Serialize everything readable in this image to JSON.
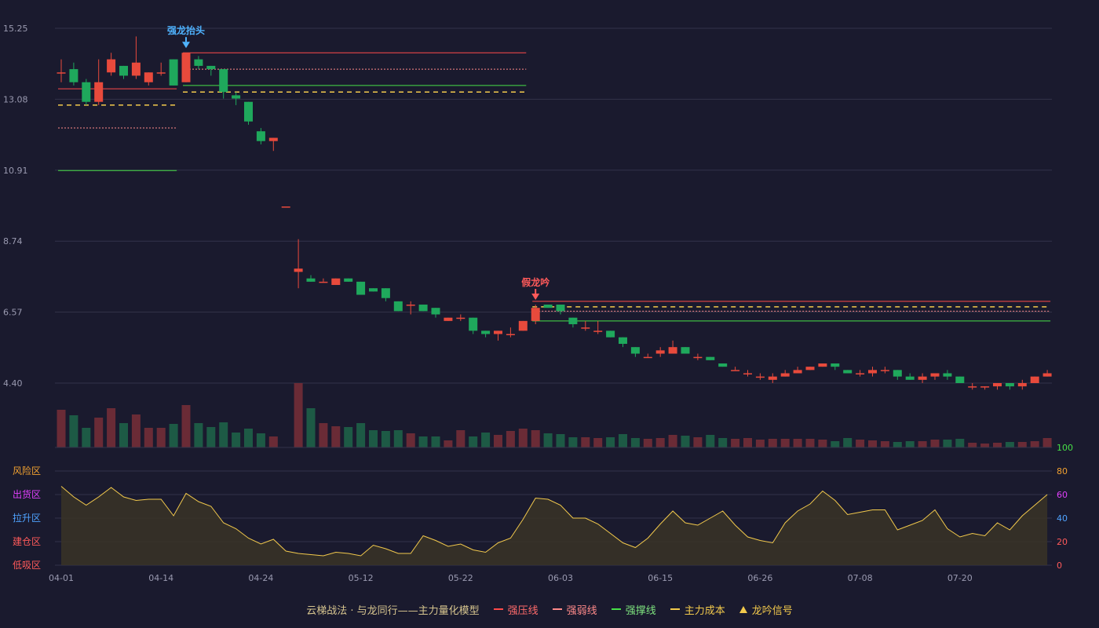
{
  "chart_data": {
    "type": "candlestick",
    "price_axis": {
      "ticks": [
        4.4,
        6.57,
        8.74,
        10.91,
        13.08,
        15.25
      ],
      "min": 4.4,
      "max": 15.25
    },
    "x_labels": [
      "04-01",
      "04-14",
      "04-24",
      "05-12",
      "05-22",
      "06-03",
      "06-15",
      "06-26",
      "07-08",
      "07-20"
    ],
    "x_label_indices": [
      0,
      8,
      16,
      24,
      32,
      40,
      48,
      56,
      64,
      72
    ],
    "candles": [
      [
        13.9,
        13.9,
        14.3,
        13.6
      ],
      [
        14.0,
        13.6,
        14.2,
        13.5
      ],
      [
        13.6,
        13.0,
        13.7,
        12.9
      ],
      [
        13.0,
        13.6,
        14.3,
        12.9
      ],
      [
        13.9,
        14.3,
        14.5,
        13.8
      ],
      [
        14.1,
        13.8,
        14.1,
        13.7
      ],
      [
        13.8,
        14.2,
        15.0,
        13.7
      ],
      [
        13.6,
        13.9,
        13.9,
        13.5
      ],
      [
        13.9,
        13.9,
        14.2,
        13.8
      ],
      [
        14.3,
        13.5,
        14.3,
        13.5
      ],
      [
        13.6,
        14.5,
        14.5,
        13.6
      ],
      [
        14.3,
        14.1,
        14.4,
        14.0
      ],
      [
        14.1,
        14.0,
        14.1,
        13.8
      ],
      [
        14.0,
        13.3,
        14.0,
        13.1
      ],
      [
        13.2,
        13.1,
        13.3,
        12.9
      ],
      [
        13.0,
        12.4,
        13.0,
        12.3
      ],
      [
        12.1,
        11.8,
        12.2,
        11.7
      ],
      [
        11.8,
        11.9,
        11.9,
        11.5
      ],
      [
        9.8,
        9.8,
        9.8,
        9.8
      ],
      [
        7.8,
        7.9,
        8.8,
        7.3
      ],
      [
        7.6,
        7.5,
        7.7,
        7.5
      ],
      [
        7.5,
        7.5,
        7.6,
        7.5
      ],
      [
        7.4,
        7.6,
        7.6,
        7.4
      ],
      [
        7.6,
        7.5,
        7.6,
        7.5
      ],
      [
        7.5,
        7.1,
        7.5,
        7.1
      ],
      [
        7.3,
        7.2,
        7.3,
        7.2
      ],
      [
        7.3,
        7.0,
        7.3,
        6.9
      ],
      [
        6.9,
        6.6,
        6.9,
        6.6
      ],
      [
        6.8,
        6.8,
        6.9,
        6.5
      ],
      [
        6.8,
        6.6,
        6.8,
        6.6
      ],
      [
        6.7,
        6.5,
        6.7,
        6.4
      ],
      [
        6.3,
        6.4,
        6.4,
        6.3
      ],
      [
        6.4,
        6.4,
        6.5,
        6.3
      ],
      [
        6.4,
        6.0,
        6.4,
        5.9
      ],
      [
        6.0,
        5.9,
        6.0,
        5.8
      ],
      [
        5.9,
        6.0,
        6.0,
        5.7
      ],
      [
        5.9,
        5.9,
        6.1,
        5.8
      ],
      [
        6.0,
        6.3,
        6.3,
        6.0
      ],
      [
        6.3,
        6.7,
        6.8,
        6.2
      ],
      [
        6.8,
        6.7,
        6.8,
        6.7
      ],
      [
        6.8,
        6.6,
        6.8,
        6.5
      ],
      [
        6.4,
        6.2,
        6.4,
        6.1
      ],
      [
        6.1,
        6.1,
        6.3,
        6.0
      ],
      [
        6.0,
        6.0,
        6.3,
        5.9
      ],
      [
        6.0,
        5.8,
        6.0,
        5.8
      ],
      [
        5.8,
        5.6,
        5.8,
        5.5
      ],
      [
        5.5,
        5.3,
        5.5,
        5.2
      ],
      [
        5.2,
        5.2,
        5.3,
        5.2
      ],
      [
        5.3,
        5.4,
        5.5,
        5.2
      ],
      [
        5.3,
        5.5,
        5.7,
        5.3
      ],
      [
        5.5,
        5.3,
        5.5,
        5.3
      ],
      [
        5.2,
        5.2,
        5.3,
        5.1
      ],
      [
        5.2,
        5.1,
        5.2,
        5.1
      ],
      [
        5.0,
        4.9,
        5.0,
        4.9
      ],
      [
        4.8,
        4.8,
        4.9,
        4.8
      ],
      [
        4.7,
        4.7,
        4.8,
        4.6
      ],
      [
        4.6,
        4.6,
        4.7,
        4.5
      ],
      [
        4.5,
        4.6,
        4.7,
        4.4
      ],
      [
        4.6,
        4.7,
        4.8,
        4.6
      ],
      [
        4.7,
        4.8,
        4.9,
        4.7
      ],
      [
        4.8,
        4.9,
        4.9,
        4.8
      ],
      [
        4.9,
        5.0,
        5.0,
        4.9
      ],
      [
        5.0,
        4.9,
        5.0,
        4.8
      ],
      [
        4.8,
        4.7,
        4.8,
        4.7
      ],
      [
        4.7,
        4.7,
        4.8,
        4.6
      ],
      [
        4.7,
        4.8,
        4.9,
        4.6
      ],
      [
        4.8,
        4.8,
        4.9,
        4.7
      ],
      [
        4.8,
        4.6,
        4.8,
        4.5
      ],
      [
        4.6,
        4.5,
        4.7,
        4.5
      ],
      [
        4.5,
        4.6,
        4.7,
        4.4
      ],
      [
        4.6,
        4.7,
        4.7,
        4.5
      ],
      [
        4.7,
        4.6,
        4.8,
        4.5
      ],
      [
        4.6,
        4.4,
        4.6,
        4.4
      ],
      [
        4.3,
        4.3,
        4.4,
        4.2
      ],
      [
        4.3,
        4.3,
        4.3,
        4.2
      ],
      [
        4.3,
        4.4,
        4.4,
        4.2
      ],
      [
        4.4,
        4.3,
        4.4,
        4.2
      ],
      [
        4.3,
        4.4,
        4.5,
        4.2
      ],
      [
        4.4,
        4.6,
        4.6,
        4.4
      ],
      [
        4.6,
        4.7,
        4.8,
        4.6
      ]
    ],
    "volumes": [
      48,
      41,
      25,
      38,
      50,
      31,
      42,
      25,
      25,
      30,
      54,
      31,
      26,
      32,
      19,
      24,
      18,
      14,
      0,
      82,
      50,
      31,
      27,
      26,
      31,
      22,
      21,
      22,
      18,
      14,
      14,
      9,
      22,
      14,
      19,
      16,
      21,
      24,
      22,
      18,
      17,
      13,
      13,
      12,
      13,
      17,
      12,
      11,
      12,
      16,
      15,
      13,
      16,
      12,
      11,
      12,
      10,
      11,
      11,
      11,
      11,
      10,
      8,
      12,
      10,
      9,
      8,
      7,
      8,
      8,
      10,
      10,
      11,
      6,
      5,
      6,
      7,
      7,
      8,
      12
    ],
    "hlines": [
      {
        "kind": "强压线",
        "value": 14.5,
        "from": 10,
        "to": 37
      },
      {
        "kind": "强弱线",
        "value": 14.0,
        "from": 10,
        "to": 37
      },
      {
        "kind": "强撑线",
        "value": 13.5,
        "from": 10,
        "to": 37
      },
      {
        "kind": "主力成本",
        "value": 13.3,
        "from": 10,
        "to": 37
      },
      {
        "kind": "强压线",
        "value": 13.4,
        "from": 0,
        "to": 9
      },
      {
        "kind": "主力成本",
        "value": 12.9,
        "from": 0,
        "to": 9
      },
      {
        "kind": "强弱线",
        "value": 12.2,
        "from": 0,
        "to": 9
      },
      {
        "kind": "强撑线",
        "value": 10.9,
        "from": 0,
        "to": 9
      },
      {
        "kind": "强压线",
        "value": 6.9,
        "from": 38,
        "to": 79
      },
      {
        "kind": "主力成本",
        "value": 6.73,
        "from": 38,
        "to": 79
      },
      {
        "kind": "强弱线",
        "value": 6.6,
        "from": 38,
        "to": 79
      },
      {
        "kind": "强撑线",
        "value": 6.3,
        "from": 38,
        "to": 79
      }
    ],
    "annotations": [
      {
        "text": "强龙抬头",
        "index": 10,
        "color": "#4fb3ff"
      },
      {
        "text": "假龙吟",
        "index": 38,
        "color": "#ff5a5a"
      }
    ],
    "indicator": {
      "values": [
        67,
        58,
        51,
        58,
        66,
        58,
        55,
        56,
        56,
        42,
        61,
        54,
        50,
        36,
        31,
        23,
        18,
        22,
        12,
        10,
        9,
        8,
        11,
        10,
        8,
        17,
        14,
        10,
        10,
        25,
        21,
        16,
        18,
        13,
        11,
        19,
        23,
        39,
        57,
        56,
        51,
        40,
        40,
        35,
        27,
        19,
        15,
        23,
        35,
        46,
        36,
        34,
        40,
        46,
        34,
        24,
        21,
        19,
        36,
        46,
        52,
        63,
        55,
        43,
        45,
        47,
        47,
        30,
        34,
        38,
        47,
        31,
        24,
        27,
        25,
        36,
        30,
        42,
        51,
        60
      ],
      "zones": [
        "风险区",
        "出货区",
        "拉升区",
        "建仓区",
        "低吸区"
      ],
      "zone_colors": [
        "#f0a030",
        "#e040fb",
        "#4fa3ff",
        "#ff5a5a",
        "#ff5a5a"
      ],
      "ticks": [
        0,
        20,
        40,
        60,
        80,
        100
      ],
      "tick_colors": [
        "#ff5a5a",
        "#ff5a5a",
        "#4fa3ff",
        "#e040fb",
        "#f0a030",
        "#47e047"
      ]
    }
  },
  "legend": {
    "title": "云梯战法 · 与龙同行——主力量化模型",
    "items": [
      "强压线",
      "强弱线",
      "强撑线",
      "主力成本",
      "龙吟信号"
    ]
  },
  "colors": {
    "up": "#e84a3c",
    "down": "#1fa85c",
    "strong_press": "#ff4a4a",
    "weak": "#ff8a8a",
    "support": "#47e047",
    "cost": "#f2c94c",
    "indicator_line": "#f2c94c"
  }
}
